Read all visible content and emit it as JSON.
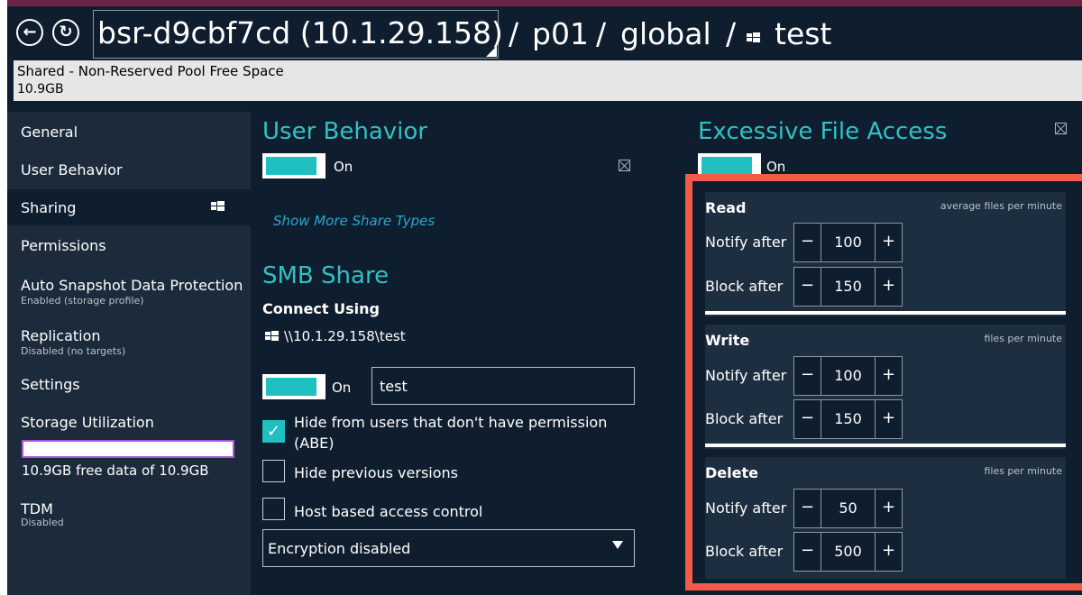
{
  "header": {
    "server": "bsr-d9cbf7cd (10.1.29.158)",
    "separator": "/",
    "pool": "p01",
    "container": "global",
    "share": "test"
  },
  "pool_bar": {
    "label": "Shared - Non-Reserved Pool Free Space",
    "value": "10.9GB"
  },
  "sidebar": {
    "items": [
      {
        "label": "General"
      },
      {
        "label": "User Behavior"
      },
      {
        "label": "Sharing"
      },
      {
        "label": "Permissions"
      },
      {
        "label": "Auto Snapshot Data Protection",
        "sub": "Enabled (storage profile)"
      },
      {
        "label": "Replication",
        "sub": "Disabled (no targets)"
      },
      {
        "label": "Settings"
      },
      {
        "label": "Storage Utilization"
      },
      {
        "label": "TDM",
        "sub": "Disabled"
      }
    ],
    "selected": "Sharing",
    "storage_text": "10.9GB free data of 10.9GB"
  },
  "user_behavior": {
    "title": "User Behavior",
    "toggle_label": "On",
    "show_more": "Show More Share Types"
  },
  "smb": {
    "title": "SMB Share",
    "connect_using": "Connect Using",
    "path": "\\\\10.1.29.158\\test",
    "toggle_label": "On",
    "share_name": "test",
    "options": [
      {
        "label": "Hide from users that don't have permission",
        "label2": "(ABE)",
        "checked": true
      },
      {
        "label": "Hide previous versions",
        "checked": false
      },
      {
        "label": "Host based access control",
        "checked": false
      }
    ],
    "encryption": "Encryption disabled"
  },
  "excessive_file_access": {
    "title": "Excessive File Access",
    "toggle_label": "On",
    "notify_label": "Notify after",
    "block_label": "Block after",
    "minus": "−",
    "plus": "+",
    "sections": [
      {
        "name": "Read",
        "unit": "average files per minute",
        "notify": "100",
        "block": "150"
      },
      {
        "name": "Write",
        "unit": "files per minute",
        "notify": "100",
        "block": "150"
      },
      {
        "name": "Delete",
        "unit": "files per minute",
        "notify": "50",
        "block": "500"
      }
    ]
  },
  "colors": {
    "accent": "#20bfc0",
    "highlight": "#f25a4c",
    "background": "#0f1e2e"
  }
}
